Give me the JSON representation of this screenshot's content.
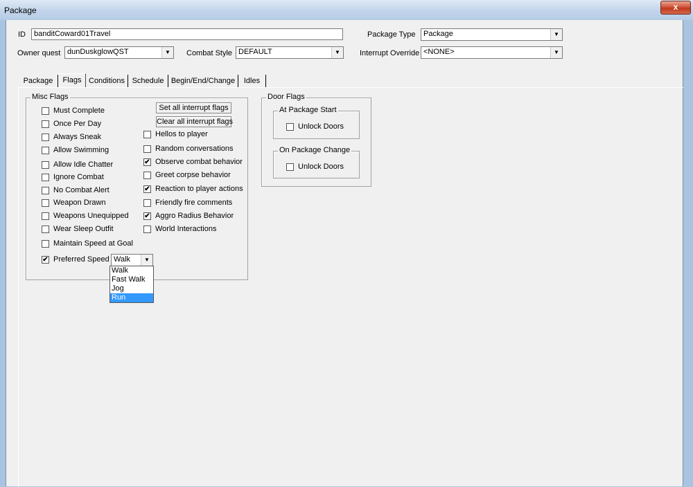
{
  "window": {
    "title": "Package",
    "close_glyph": "x"
  },
  "header": {
    "id_label": "ID",
    "id_value": "banditCoward01Travel",
    "package_type_label": "Package Type",
    "package_type_value": "Package",
    "owner_quest_label": "Owner quest",
    "owner_quest_value": "dunDuskglowQST",
    "combat_style_label": "Combat Style",
    "combat_style_value": "DEFAULT",
    "interrupt_override_label": "Interrupt Override",
    "interrupt_override_value": "<NONE>"
  },
  "tabs": [
    {
      "label": "Package"
    },
    {
      "label": "Flags"
    },
    {
      "label": "Conditions"
    },
    {
      "label": "Schedule"
    },
    {
      "label": "Begin/End/Change"
    },
    {
      "label": "Idles"
    }
  ],
  "active_tab": "Flags",
  "misc_flags": {
    "title": "Misc Flags",
    "left": [
      {
        "label": "Must Complete",
        "checked": false
      },
      {
        "label": "Once Per Day",
        "checked": false
      },
      {
        "label": "Always Sneak",
        "checked": false
      },
      {
        "label": "Allow Swimming",
        "checked": false
      },
      {
        "label": "Allow Idle Chatter",
        "checked": false
      },
      {
        "label": "Ignore Combat",
        "checked": false
      },
      {
        "label": "No Combat Alert",
        "checked": false
      },
      {
        "label": "Weapon Drawn",
        "checked": false
      },
      {
        "label": "Weapons Unequipped",
        "checked": false
      },
      {
        "label": "Wear Sleep Outfit",
        "checked": false
      },
      {
        "label": "Maintain Speed at Goal",
        "checked": false
      },
      {
        "label": "Preferred Speed",
        "checked": true
      }
    ],
    "set_all_button": "Set all interrupt flags",
    "clear_all_button": "Clear all interrupt flags",
    "right": [
      {
        "label": "Hellos to player",
        "checked": false
      },
      {
        "label": "Random conversations",
        "checked": false
      },
      {
        "label": "Observe combat behavior",
        "checked": true
      },
      {
        "label": "Greet corpse behavior",
        "checked": false
      },
      {
        "label": "Reaction to player actions",
        "checked": true
      },
      {
        "label": "Friendly fire comments",
        "checked": false
      },
      {
        "label": "Aggro Radius Behavior",
        "checked": true
      },
      {
        "label": "World Interactions",
        "checked": false
      }
    ],
    "preferred_speed": {
      "value": "Walk",
      "options": [
        "Walk",
        "Fast Walk",
        "Jog",
        "Run"
      ],
      "highlighted": "Run"
    }
  },
  "door_flags": {
    "title": "Door Flags",
    "at_start": {
      "title": "At Package Start",
      "label": "Unlock Doors",
      "checked": false
    },
    "on_change": {
      "title": "On Package Change",
      "label": "Unlock Doors",
      "checked": false
    }
  },
  "glyphs": {
    "check": "✔",
    "arrow": "▼"
  },
  "colors": {
    "highlight": "#3399ff",
    "title_bar": "#c4d6ec",
    "close_button": "#c9452a"
  }
}
